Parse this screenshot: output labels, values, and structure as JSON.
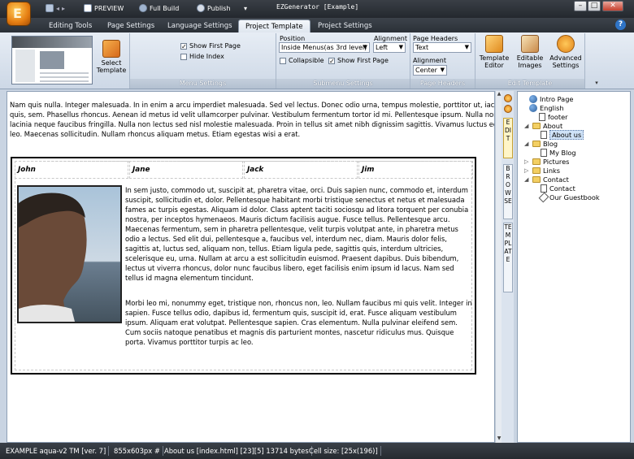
{
  "window": {
    "title": "EZGenerator  [Example]",
    "quick_access": {
      "preview": "PREVIEW",
      "full_build": "Full Build",
      "publish": "Publish",
      "dropdown": "▾"
    },
    "controls": {
      "minimize": "–",
      "maximize": "□",
      "close": "✕"
    }
  },
  "ribbon_tabs": [
    "Editing Tools",
    "Page Settings",
    "Language Settings",
    "Project Template",
    "Project Settings"
  ],
  "active_tab": "Project Template",
  "ribbon": {
    "select_template": "Select Template",
    "menu_settings": {
      "label": "Menu Settings",
      "show_first_page": "Show First Page",
      "show_first_page_checked": true,
      "hide_index": "Hide Index",
      "hide_index_checked": false
    },
    "submenu_settings": {
      "label": "Submenu Settings",
      "position_label": "Position",
      "position_value": "Inside Menus(as 3rd level)",
      "alignment_label": "Alignment",
      "alignment_value": "Left",
      "collapsible": "Collapsible",
      "collapsible_checked": false,
      "show_first_page": "Show First Page",
      "show_first_page_checked": true
    },
    "page_headers": {
      "label": "Page Headers",
      "type_label": "Page Headers Type",
      "type_value": "Text",
      "alignment_label": "Alignment",
      "alignment_value": "Center"
    },
    "edit_template": {
      "label": "Edit Template",
      "template_editor": "Template Editor",
      "editable_images": "Editable Images",
      "advanced_settings": "Advanced Settings"
    }
  },
  "editor": {
    "intro_lines": [
      "Nam quis nulla. Integer malesuada. In in enim a arcu imperdiet malesuada. Sed vel lectus. Donec odio urna, tempus molestie, porttitor ut, iaculis",
      "quis, sem. Phasellus rhoncus. Aenean id metus id velit ullamcorper pulvinar. Vestibulum fermentum tortor id mi. Pellentesque ipsum. Nulla non arcu",
      "lacinia neque faucibus fringilla. Nulla non lectus sed nisl molestie malesuada. Proin in tellus sit amet nibh dignissim sagittis. Vivamus luctus egestas",
      "leo. Maecenas sollicitudin. Nullam rhoncus aliquam metus. Etiam egestas wisi a erat."
    ],
    "headers": [
      "John",
      "Jane",
      "Jack",
      "Jim"
    ],
    "para1": "In sem justo, commodo ut, suscipit at, pharetra vitae, orci. Duis sapien nunc, commodo et, interdum suscipit, sollicitudin et, dolor. Pellentesque habitant morbi tristique senectus et netus et malesuada fames ac turpis egestas. Aliquam id dolor. Class aptent taciti sociosqu ad litora torquent per conubia nostra, per inceptos hymenaeos. Mauris dictum facilisis augue. Fusce tellus. Pellentesque arcu. Maecenas fermentum, sem in pharetra pellentesque, velit turpis volutpat ante, in pharetra metus odio a lectus. Sed elit dui, pellentesque a, faucibus vel, interdum nec, diam. Mauris dolor felis, sagittis at, luctus sed, aliquam non, tellus. Etiam ligula pede, sagittis quis, interdum ultricies, scelerisque eu, urna. Nullam at arcu a est sollicitudin euismod. Praesent dapibus. Duis bibendum, lectus ut viverra rhoncus, dolor nunc faucibus libero, eget facilisis enim ipsum id lacus. Nam sed tellus id magna elementum tincidunt.",
    "para2": "Morbi leo mi, nonummy eget, tristique non, rhoncus non, leo. Nullam faucibus mi quis velit. Integer in sapien. Fusce tellus odio, dapibus id, fermentum quis, suscipit id, erat. Fusce aliquam vestibulum ipsum. Aliquam erat volutpat. Pellentesque sapien. Cras elementum. Nulla pulvinar eleifend sem. Cum sociis natoque penatibus et magnis dis parturient montes, nascetur ridiculus mus. Quisque porta. Vivamus porttitor turpis ac leo."
  },
  "side_tabs": [
    "EDIT",
    "BROWSE",
    "TEMPLATE"
  ],
  "tree": {
    "nodes": [
      {
        "label": "Intro Page",
        "type": "globe",
        "level": 0
      },
      {
        "label": "English",
        "type": "globe",
        "level": 0
      },
      {
        "label": "footer",
        "type": "doc",
        "level": 1
      },
      {
        "label": "About",
        "type": "folder",
        "level": 1,
        "expanded": true
      },
      {
        "label": "About us",
        "type": "doc",
        "level": 2,
        "selected": true
      },
      {
        "label": "Blog",
        "type": "folder",
        "level": 1,
        "expanded": true
      },
      {
        "label": "My Blog",
        "type": "doc",
        "level": 2
      },
      {
        "label": "Pictures",
        "type": "folder",
        "level": 1
      },
      {
        "label": "Links",
        "type": "folder",
        "level": 1
      },
      {
        "label": "Contact",
        "type": "folder",
        "level": 1,
        "expanded": true
      },
      {
        "label": "Contact",
        "type": "doc",
        "level": 2
      },
      {
        "label": "Our Guestbook",
        "type": "doc",
        "level": 2
      }
    ]
  },
  "status": {
    "template": "EXAMPLE aqua-v2 TM [ver. 7]",
    "page_size": "855x603px #",
    "page_info": "About us [index.html] [23][5] 13714 bytes",
    "cell_size": "Cell size: [25x(196)]"
  }
}
